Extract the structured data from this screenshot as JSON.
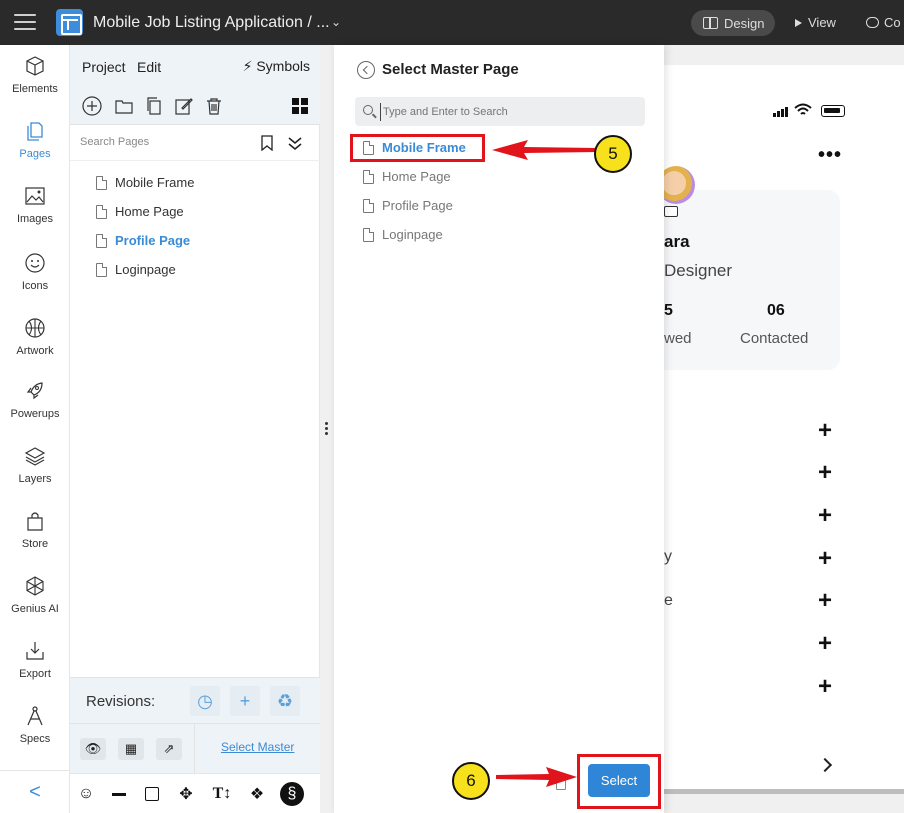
{
  "topbar": {
    "doc_title": "Mobile Job Listing Application / ...",
    "design_label": "Design",
    "view_label": "View",
    "comment_label": "Co"
  },
  "rail": {
    "items": [
      {
        "label": "Elements",
        "icon": "cube-icon"
      },
      {
        "label": "Pages",
        "icon": "pages-icon"
      },
      {
        "label": "Images",
        "icon": "image-icon"
      },
      {
        "label": "Icons",
        "icon": "smiley-icon"
      },
      {
        "label": "Artwork",
        "icon": "basketball-icon"
      },
      {
        "label": "Powerups",
        "icon": "rocket-icon"
      },
      {
        "label": "Layers",
        "icon": "layers-icon"
      },
      {
        "label": "Store",
        "icon": "bag-icon"
      },
      {
        "label": "Genius AI",
        "icon": "ai-icon"
      },
      {
        "label": "Export",
        "icon": "export-icon"
      },
      {
        "label": "Specs",
        "icon": "compass-icon"
      }
    ],
    "collapse_glyph": "<"
  },
  "pages_panel": {
    "tab_project": "Project",
    "tab_edit": "Edit",
    "symbols_label": "Symbols",
    "search_placeholder": "Search Pages",
    "pages": [
      {
        "name": "Mobile Frame",
        "active": false
      },
      {
        "name": "Home Page",
        "active": false
      },
      {
        "name": "Profile Page",
        "active": true
      },
      {
        "name": "Loginpage",
        "active": false
      }
    ],
    "revisions_label": "Revisions:",
    "select_master_link": "Select Master"
  },
  "modal": {
    "title": "Select Master Page",
    "search_placeholder": "Type and Enter to Search",
    "pages": [
      {
        "name": "Mobile Frame",
        "active": true
      },
      {
        "name": "Home Page",
        "active": false
      },
      {
        "name": "Profile Page",
        "active": false
      },
      {
        "name": "Loginpage",
        "active": false
      }
    ],
    "select_button": "Select"
  },
  "annotations": {
    "badge_5": "5",
    "badge_6": "6",
    "highlight_color": "#e1141b",
    "badge_color": "#f7e11c"
  },
  "phone": {
    "name_fragment": "ara",
    "role_fragment": "Designer",
    "stat1_value": "5",
    "stat1_label": "wed",
    "stat2_value": "06",
    "stat2_label": "Contacted",
    "frag_y": "y",
    "frag_e": "e"
  },
  "colors": {
    "accent": "#3a8bd6",
    "topbar": "#2a2a2a",
    "select_button": "#2f86d6"
  }
}
